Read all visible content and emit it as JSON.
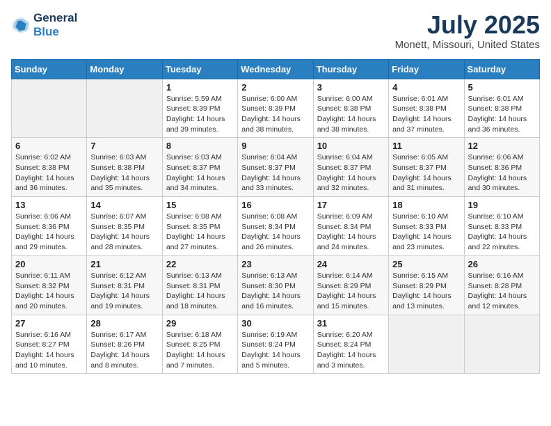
{
  "logo": {
    "line1": "General",
    "line2": "Blue"
  },
  "title": "July 2025",
  "subtitle": "Monett, Missouri, United States",
  "days_of_week": [
    "Sunday",
    "Monday",
    "Tuesday",
    "Wednesday",
    "Thursday",
    "Friday",
    "Saturday"
  ],
  "weeks": [
    [
      {
        "day": "",
        "sunrise": "",
        "sunset": "",
        "daylight": ""
      },
      {
        "day": "",
        "sunrise": "",
        "sunset": "",
        "daylight": ""
      },
      {
        "day": "1",
        "sunrise": "Sunrise: 5:59 AM",
        "sunset": "Sunset: 8:39 PM",
        "daylight": "Daylight: 14 hours and 39 minutes."
      },
      {
        "day": "2",
        "sunrise": "Sunrise: 6:00 AM",
        "sunset": "Sunset: 8:39 PM",
        "daylight": "Daylight: 14 hours and 38 minutes."
      },
      {
        "day": "3",
        "sunrise": "Sunrise: 6:00 AM",
        "sunset": "Sunset: 8:38 PM",
        "daylight": "Daylight: 14 hours and 38 minutes."
      },
      {
        "day": "4",
        "sunrise": "Sunrise: 6:01 AM",
        "sunset": "Sunset: 8:38 PM",
        "daylight": "Daylight: 14 hours and 37 minutes."
      },
      {
        "day": "5",
        "sunrise": "Sunrise: 6:01 AM",
        "sunset": "Sunset: 8:38 PM",
        "daylight": "Daylight: 14 hours and 36 minutes."
      }
    ],
    [
      {
        "day": "6",
        "sunrise": "Sunrise: 6:02 AM",
        "sunset": "Sunset: 8:38 PM",
        "daylight": "Daylight: 14 hours and 36 minutes."
      },
      {
        "day": "7",
        "sunrise": "Sunrise: 6:03 AM",
        "sunset": "Sunset: 8:38 PM",
        "daylight": "Daylight: 14 hours and 35 minutes."
      },
      {
        "day": "8",
        "sunrise": "Sunrise: 6:03 AM",
        "sunset": "Sunset: 8:37 PM",
        "daylight": "Daylight: 14 hours and 34 minutes."
      },
      {
        "day": "9",
        "sunrise": "Sunrise: 6:04 AM",
        "sunset": "Sunset: 8:37 PM",
        "daylight": "Daylight: 14 hours and 33 minutes."
      },
      {
        "day": "10",
        "sunrise": "Sunrise: 6:04 AM",
        "sunset": "Sunset: 8:37 PM",
        "daylight": "Daylight: 14 hours and 32 minutes."
      },
      {
        "day": "11",
        "sunrise": "Sunrise: 6:05 AM",
        "sunset": "Sunset: 8:37 PM",
        "daylight": "Daylight: 14 hours and 31 minutes."
      },
      {
        "day": "12",
        "sunrise": "Sunrise: 6:06 AM",
        "sunset": "Sunset: 8:36 PM",
        "daylight": "Daylight: 14 hours and 30 minutes."
      }
    ],
    [
      {
        "day": "13",
        "sunrise": "Sunrise: 6:06 AM",
        "sunset": "Sunset: 8:36 PM",
        "daylight": "Daylight: 14 hours and 29 minutes."
      },
      {
        "day": "14",
        "sunrise": "Sunrise: 6:07 AM",
        "sunset": "Sunset: 8:35 PM",
        "daylight": "Daylight: 14 hours and 28 minutes."
      },
      {
        "day": "15",
        "sunrise": "Sunrise: 6:08 AM",
        "sunset": "Sunset: 8:35 PM",
        "daylight": "Daylight: 14 hours and 27 minutes."
      },
      {
        "day": "16",
        "sunrise": "Sunrise: 6:08 AM",
        "sunset": "Sunset: 8:34 PM",
        "daylight": "Daylight: 14 hours and 26 minutes."
      },
      {
        "day": "17",
        "sunrise": "Sunrise: 6:09 AM",
        "sunset": "Sunset: 8:34 PM",
        "daylight": "Daylight: 14 hours and 24 minutes."
      },
      {
        "day": "18",
        "sunrise": "Sunrise: 6:10 AM",
        "sunset": "Sunset: 8:33 PM",
        "daylight": "Daylight: 14 hours and 23 minutes."
      },
      {
        "day": "19",
        "sunrise": "Sunrise: 6:10 AM",
        "sunset": "Sunset: 8:33 PM",
        "daylight": "Daylight: 14 hours and 22 minutes."
      }
    ],
    [
      {
        "day": "20",
        "sunrise": "Sunrise: 6:11 AM",
        "sunset": "Sunset: 8:32 PM",
        "daylight": "Daylight: 14 hours and 20 minutes."
      },
      {
        "day": "21",
        "sunrise": "Sunrise: 6:12 AM",
        "sunset": "Sunset: 8:31 PM",
        "daylight": "Daylight: 14 hours and 19 minutes."
      },
      {
        "day": "22",
        "sunrise": "Sunrise: 6:13 AM",
        "sunset": "Sunset: 8:31 PM",
        "daylight": "Daylight: 14 hours and 18 minutes."
      },
      {
        "day": "23",
        "sunrise": "Sunrise: 6:13 AM",
        "sunset": "Sunset: 8:30 PM",
        "daylight": "Daylight: 14 hours and 16 minutes."
      },
      {
        "day": "24",
        "sunrise": "Sunrise: 6:14 AM",
        "sunset": "Sunset: 8:29 PM",
        "daylight": "Daylight: 14 hours and 15 minutes."
      },
      {
        "day": "25",
        "sunrise": "Sunrise: 6:15 AM",
        "sunset": "Sunset: 8:29 PM",
        "daylight": "Daylight: 14 hours and 13 minutes."
      },
      {
        "day": "26",
        "sunrise": "Sunrise: 6:16 AM",
        "sunset": "Sunset: 8:28 PM",
        "daylight": "Daylight: 14 hours and 12 minutes."
      }
    ],
    [
      {
        "day": "27",
        "sunrise": "Sunrise: 6:16 AM",
        "sunset": "Sunset: 8:27 PM",
        "daylight": "Daylight: 14 hours and 10 minutes."
      },
      {
        "day": "28",
        "sunrise": "Sunrise: 6:17 AM",
        "sunset": "Sunset: 8:26 PM",
        "daylight": "Daylight: 14 hours and 8 minutes."
      },
      {
        "day": "29",
        "sunrise": "Sunrise: 6:18 AM",
        "sunset": "Sunset: 8:25 PM",
        "daylight": "Daylight: 14 hours and 7 minutes."
      },
      {
        "day": "30",
        "sunrise": "Sunrise: 6:19 AM",
        "sunset": "Sunset: 8:24 PM",
        "daylight": "Daylight: 14 hours and 5 minutes."
      },
      {
        "day": "31",
        "sunrise": "Sunrise: 6:20 AM",
        "sunset": "Sunset: 8:24 PM",
        "daylight": "Daylight: 14 hours and 3 minutes."
      },
      {
        "day": "",
        "sunrise": "",
        "sunset": "",
        "daylight": ""
      },
      {
        "day": "",
        "sunrise": "",
        "sunset": "",
        "daylight": ""
      }
    ]
  ]
}
